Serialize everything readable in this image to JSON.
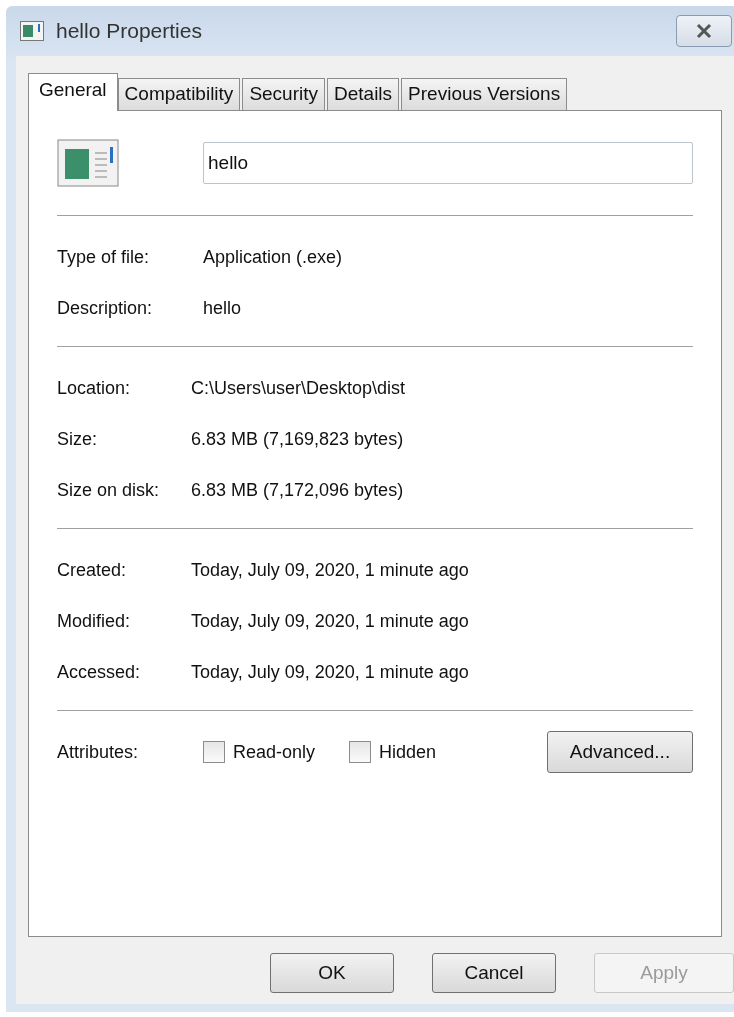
{
  "window": {
    "title": "hello Properties"
  },
  "tabs": [
    {
      "label": "General",
      "selected": true
    },
    {
      "label": "Compatibility",
      "selected": false
    },
    {
      "label": "Security",
      "selected": false
    },
    {
      "label": "Details",
      "selected": false
    },
    {
      "label": "Previous Versions",
      "selected": false
    }
  ],
  "name_field": {
    "value": "hello"
  },
  "groups": [
    {
      "rows": [
        {
          "label": "Type of file:",
          "value": "Application (.exe)"
        },
        {
          "label": "Description:",
          "value": "hello"
        }
      ]
    },
    {
      "rows": [
        {
          "label": "Location:",
          "value": "C:\\Users\\user\\Desktop\\dist"
        },
        {
          "label": "Size:",
          "value": "6.83 MB (7,169,823 bytes)"
        },
        {
          "label": "Size on disk:",
          "value": "6.83 MB (7,172,096 bytes)"
        }
      ]
    },
    {
      "rows": [
        {
          "label": "Created:",
          "value": "Today, July 09, 2020, 1 minute ago"
        },
        {
          "label": "Modified:",
          "value": "Today, July 09, 2020, 1 minute ago"
        },
        {
          "label": "Accessed:",
          "value": "Today, July 09, 2020, 1 minute ago"
        }
      ]
    }
  ],
  "attributes": {
    "label": "Attributes:",
    "checkboxes": [
      {
        "label": "Read-only",
        "checked": false
      },
      {
        "label": "Hidden",
        "checked": false
      }
    ],
    "button": "Advanced..."
  },
  "buttons": [
    {
      "label": "OK",
      "disabled": false
    },
    {
      "label": "Cancel",
      "disabled": false
    },
    {
      "label": "Apply",
      "disabled": true
    }
  ]
}
